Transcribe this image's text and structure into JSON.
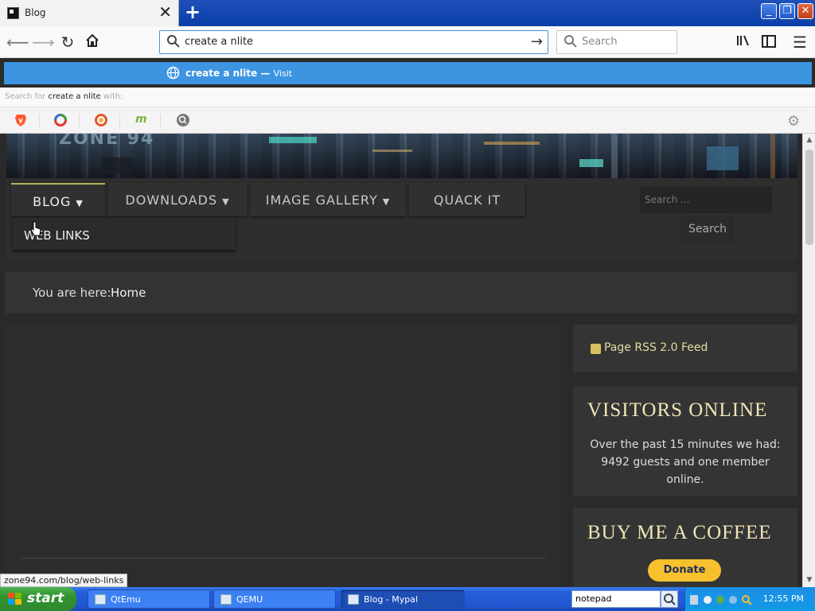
{
  "browser": {
    "tab_title": "Blog",
    "url_value": "create a nlite",
    "search_placeholder": "Search",
    "suggestion": {
      "text": "create a nlite",
      "separator": " — ",
      "action": "Visit"
    },
    "search_for": {
      "prefix": "Search for",
      "query": "create a nlite",
      "suffix": "with:"
    },
    "engines": [
      "brave-icon",
      "qwant-icon",
      "duckduckgo-icon",
      "mojeek-icon",
      "searx-icon"
    ],
    "status_link": "zone94.com/blog/web-links"
  },
  "site": {
    "banner_logo": "ZONE 94",
    "menu": [
      {
        "label": "BLOG",
        "has_dropdown": true
      },
      {
        "label": "DOWNLOADS",
        "has_dropdown": true
      },
      {
        "label": "IMAGE GALLERY",
        "has_dropdown": true
      },
      {
        "label": "QUACK IT",
        "has_dropdown": false
      }
    ],
    "submenu": {
      "label": "WEB LINKS"
    },
    "search_placeholder": "Search ...",
    "search_button": "Search",
    "breadcrumb": {
      "label": "You are here:",
      "home": "Home"
    },
    "sidebar": {
      "rss": "Page RSS 2.0 Feed",
      "visitors_title": "VISITORS ONLINE",
      "visitors_text": "Over the past 15 minutes we had: 9492 guests and one member online.",
      "coffee_title": "BUY ME A COFFEE",
      "donate": "Donate"
    }
  },
  "taskbar": {
    "start": "start",
    "tasks": [
      {
        "label": "QtEmu",
        "active": false
      },
      {
        "label": "QEMU",
        "active": false
      },
      {
        "label": "Blog - Mypal",
        "active": true
      }
    ],
    "search_value": "notepad",
    "clock": "12:55 PM"
  },
  "colors": {
    "accent_blue": "#3d94e0",
    "menu_highlight": "#b8b25a",
    "sidebar_title": "#f0e6b6",
    "donate_yellow": "#f7c12d"
  }
}
